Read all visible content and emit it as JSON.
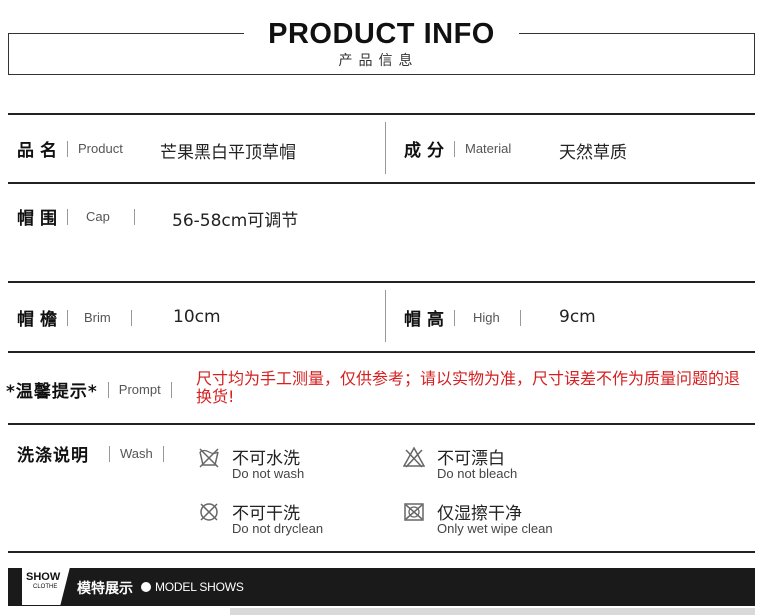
{
  "header": {
    "title": "PRODUCT INFO",
    "subtitle": "产品信息"
  },
  "rows": {
    "name": {
      "label_cn": "品名",
      "label_en": "Product",
      "value": "芒果黑白平顶草帽"
    },
    "material": {
      "label_cn": "成分",
      "label_en": "Material",
      "value": "天然草质"
    },
    "cap": {
      "label_cn": "帽围",
      "label_en": "Cap",
      "value": "56-58cm可调节"
    },
    "brim": {
      "label_cn": "帽檐",
      "label_en": "Brim",
      "value": "10cm"
    },
    "high": {
      "label_cn": "帽高",
      "label_en": "High",
      "value": "9cm"
    },
    "prompt": {
      "label_cn": "*温馨提示*",
      "label_en": "Prompt",
      "value": "尺寸均为手工测量，仅供参考；请以实物为准，尺寸误差不作为质量问题的退换货!"
    }
  },
  "wash": {
    "label_cn": "洗涤说明",
    "label_en": "Wash",
    "items": [
      {
        "cn": "不可水洗",
        "en": "Do not wash",
        "icon": "no-wash-icon"
      },
      {
        "cn": "不可漂白",
        "en": "Do not bleach",
        "icon": "no-bleach-icon"
      },
      {
        "cn": "不可干洗",
        "en": "Do not dryclean",
        "icon": "no-dryclean-icon"
      },
      {
        "cn": "仅湿擦干净",
        "en": "Only wet wipe clean",
        "icon": "wet-wipe-icon"
      }
    ]
  },
  "banner": {
    "badge_top": "SHOW",
    "badge_bottom": "CLOTHE",
    "title_cn": "模特展示",
    "title_en": "MODEL SHOWS"
  }
}
